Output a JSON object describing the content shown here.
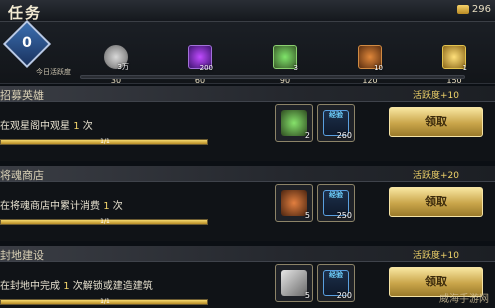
{
  "header": {
    "title": "任务",
    "currency_value": "296"
  },
  "activity": {
    "current": "0",
    "label": "今日活跃度",
    "progress": 0,
    "milestones": [
      {
        "value": "30",
        "reward_count": "3万",
        "chest": "silver"
      },
      {
        "value": "60",
        "reward_count": "200",
        "chest": "purple"
      },
      {
        "value": "90",
        "reward_count": "3",
        "chest": "green"
      },
      {
        "value": "120",
        "reward_count": "10",
        "chest": "orange"
      },
      {
        "value": "150",
        "reward_count": "1",
        "chest": "gold"
      }
    ]
  },
  "tasks": [
    {
      "name": "招募英雄",
      "bonus": "活跃度+10",
      "desc_pre": "在观星阁中观星 ",
      "desc_num": "1",
      "desc_post": " 次",
      "progress_text": "1/1",
      "progress": 1.0,
      "reward_item_qty": "2",
      "reward_item_icon": "green-gem-icon",
      "exp_label": "经验",
      "exp_qty": "260",
      "claim_label": "领取"
    },
    {
      "name": "将魂商店",
      "bonus": "活跃度+20",
      "desc_pre": "在将魂商店中累计消费 ",
      "desc_num": "1",
      "desc_post": " 次",
      "progress_text": "1/1",
      "progress": 1.0,
      "reward_item_qty": "5",
      "reward_item_icon": "scroll-icon",
      "exp_label": "经验",
      "exp_qty": "250",
      "claim_label": "领取"
    },
    {
      "name": "封地建设",
      "bonus": "活跃度+10",
      "desc_pre": "在封地中完成 ",
      "desc_num": "1",
      "desc_post": " 次解锁或建造建筑",
      "progress_text": "1/1",
      "progress": 1.0,
      "reward_item_qty": "5",
      "reward_item_icon": "hammer-icon",
      "exp_label": "经验",
      "exp_qty": "200",
      "claim_label": "领取"
    }
  ],
  "watermark": "威海手游网"
}
